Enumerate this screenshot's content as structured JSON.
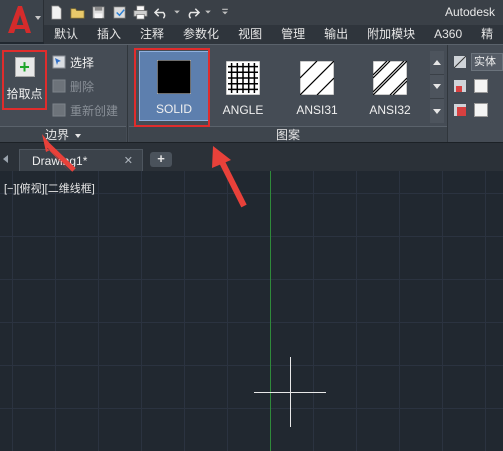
{
  "window": {
    "title": "Autodesk"
  },
  "app_button": {
    "icon": "autocad-a-logo"
  },
  "quick_access": {
    "buttons": [
      "new-file-icon",
      "open-folder-icon",
      "save-icon",
      "save-as-icon",
      "print-icon",
      "undo-icon",
      "redo-icon",
      "dropdown-icon"
    ]
  },
  "ribbon_tabs": [
    "默认",
    "插入",
    "注释",
    "参数化",
    "视图",
    "管理",
    "输出",
    "附加模块",
    "A360",
    "精"
  ],
  "boundary_panel": {
    "title": "边界",
    "pick_point_label": "拾取点",
    "select_label": "选择",
    "delete_label": "删除",
    "recreate_label": "重新创建"
  },
  "pattern_panel": {
    "title": "图案",
    "patterns": [
      {
        "label": "SOLID",
        "selected": true
      },
      {
        "label": "ANGLE",
        "selected": false
      },
      {
        "label": "ANSI31",
        "selected": false
      },
      {
        "label": "ANSI32",
        "selected": false
      }
    ]
  },
  "properties_panel": {
    "fill_type": "实体"
  },
  "document": {
    "tab_label": "Drawing1*",
    "close_glyph": "✕",
    "new_tab_glyph": "+"
  },
  "viewport": {
    "label": "[−][俯视][二维线框]"
  },
  "colors": {
    "highlight_outline": "#e02c2c",
    "annotation_arrow": "#e8413a",
    "selected_pattern": "#5d7fae",
    "y_axis": "#2f8a3a",
    "canvas_bg": "#212830"
  }
}
